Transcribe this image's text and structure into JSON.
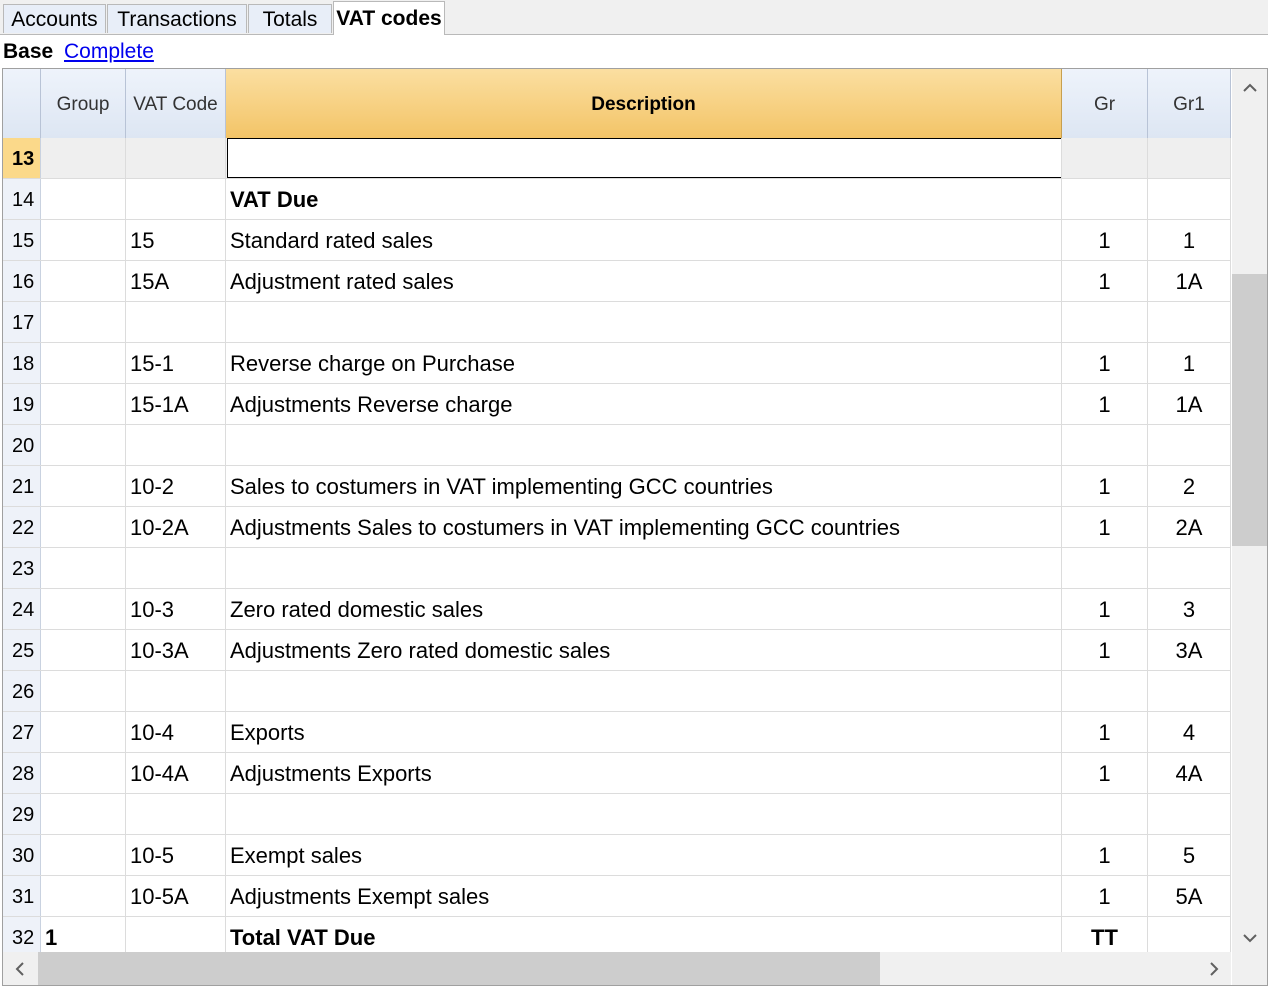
{
  "tabs": [
    {
      "label": "Accounts",
      "active": false
    },
    {
      "label": "Transactions",
      "active": false
    },
    {
      "label": "Totals",
      "active": false
    },
    {
      "label": "VAT codes",
      "active": true
    }
  ],
  "views": {
    "base": "Base",
    "complete": "Complete"
  },
  "columns": {
    "group": "Group",
    "vat_code": "VAT Code",
    "description": "Description",
    "gr": "Gr",
    "gr1": "Gr1"
  },
  "rows": [
    {
      "rn": "13",
      "group": "",
      "vat": "",
      "desc": "",
      "gr": "",
      "gr1": "",
      "selected": true
    },
    {
      "rn": "14",
      "group": "",
      "vat": "",
      "desc": "VAT Due",
      "gr": "",
      "gr1": "",
      "bold": true
    },
    {
      "rn": "15",
      "group": "",
      "vat": "15",
      "desc": "Standard rated sales",
      "gr": "1",
      "gr1": "1"
    },
    {
      "rn": "16",
      "group": "",
      "vat": "15A",
      "desc": "Adjustment rated sales",
      "gr": "1",
      "gr1": "1A"
    },
    {
      "rn": "17",
      "group": "",
      "vat": "",
      "desc": "",
      "gr": "",
      "gr1": ""
    },
    {
      "rn": "18",
      "group": "",
      "vat": "15-1",
      "desc": "Reverse charge on Purchase",
      "gr": "1",
      "gr1": "1"
    },
    {
      "rn": "19",
      "group": "",
      "vat": "15-1A",
      "desc": "Adjustments Reverse charge",
      "gr": "1",
      "gr1": "1A"
    },
    {
      "rn": "20",
      "group": "",
      "vat": "",
      "desc": "",
      "gr": "",
      "gr1": ""
    },
    {
      "rn": "21",
      "group": "",
      "vat": "10-2",
      "desc": "Sales to costumers in VAT implementing GCC countries",
      "gr": "1",
      "gr1": "2"
    },
    {
      "rn": "22",
      "group": "",
      "vat": "10-2A",
      "desc": "Adjustments Sales to costumers in VAT implementing GCC countries",
      "gr": "1",
      "gr1": "2A"
    },
    {
      "rn": "23",
      "group": "",
      "vat": "",
      "desc": "",
      "gr": "",
      "gr1": ""
    },
    {
      "rn": "24",
      "group": "",
      "vat": "10-3",
      "desc": "Zero rated domestic sales",
      "gr": "1",
      "gr1": "3"
    },
    {
      "rn": "25",
      "group": "",
      "vat": "10-3A",
      "desc": "Adjustments Zero rated domestic sales",
      "gr": "1",
      "gr1": "3A"
    },
    {
      "rn": "26",
      "group": "",
      "vat": "",
      "desc": "",
      "gr": "",
      "gr1": ""
    },
    {
      "rn": "27",
      "group": "",
      "vat": "10-4",
      "desc": "Exports",
      "gr": "1",
      "gr1": "4"
    },
    {
      "rn": "28",
      "group": "",
      "vat": "10-4A",
      "desc": "Adjustments Exports",
      "gr": "1",
      "gr1": "4A"
    },
    {
      "rn": "29",
      "group": "",
      "vat": "",
      "desc": "",
      "gr": "",
      "gr1": ""
    },
    {
      "rn": "30",
      "group": "",
      "vat": "10-5",
      "desc": "Exempt sales",
      "gr": "1",
      "gr1": "5"
    },
    {
      "rn": "31",
      "group": "",
      "vat": "10-5A",
      "desc": "Adjustments Exempt sales",
      "gr": "1",
      "gr1": "5A"
    },
    {
      "rn": "32",
      "group": "1",
      "vat": "",
      "desc": "Total VAT Due",
      "gr": "TT",
      "gr1": "",
      "bold": true
    }
  ],
  "icons": {
    "scroll_up": "chevron-up-icon",
    "scroll_down": "chevron-down-icon",
    "scroll_left": "chevron-left-icon",
    "scroll_right": "chevron-right-icon"
  },
  "colors": {
    "header": "#dde6f3",
    "description_header": "#f3c467",
    "selected_row_number": "#fbd98a"
  }
}
